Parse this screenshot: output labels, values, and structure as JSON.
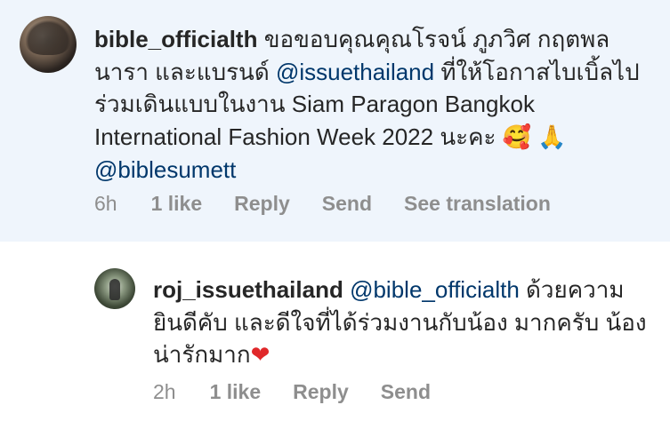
{
  "comments": [
    {
      "username": "bible_officialth",
      "text_segments": [
        {
          "type": "text",
          "value": "ขอขอบคุณคุณโรจน์ ภูภวิศ กฤตพลนารา และแบรนด์ "
        },
        {
          "type": "mention",
          "value": "@issuethailand"
        },
        {
          "type": "text",
          "value": " ที่ให้โอกาสไบเบิ้ลไปร่วมเดินแบบในงาน Siam Paragon Bangkok International Fashion Week 2022 นะคะ "
        },
        {
          "type": "emoji",
          "value": "🥰",
          "name": "smiling-face-with-hearts-emoji"
        },
        {
          "type": "text",
          "value": " "
        },
        {
          "type": "emoji",
          "value": "🙏",
          "name": "folded-hands-emoji"
        },
        {
          "type": "text",
          "value": " "
        },
        {
          "type": "mention",
          "value": "@biblesumett"
        }
      ],
      "time": "6h",
      "likes": "1 like",
      "actions": [
        "Reply",
        "Send",
        "See translation"
      ]
    },
    {
      "username": "roj_issuethailand",
      "text_segments": [
        {
          "type": "mention",
          "value": "@bible_officialth"
        },
        {
          "type": "text",
          "value": " ด้วยความยินดีคับ และดีใจที่ได้ร่วมงานกับน้อง มากครับ น้องน่ารักมาก"
        },
        {
          "type": "emoji",
          "value": "❤",
          "name": "red-heart-emoji"
        }
      ],
      "time": "2h",
      "likes": "1 like",
      "actions": [
        "Reply",
        "Send"
      ]
    }
  ],
  "colors": {
    "highlight_bg": "#eff5fc",
    "mention": "#00376b",
    "meta": "#8e8e8e",
    "text": "#262626"
  }
}
